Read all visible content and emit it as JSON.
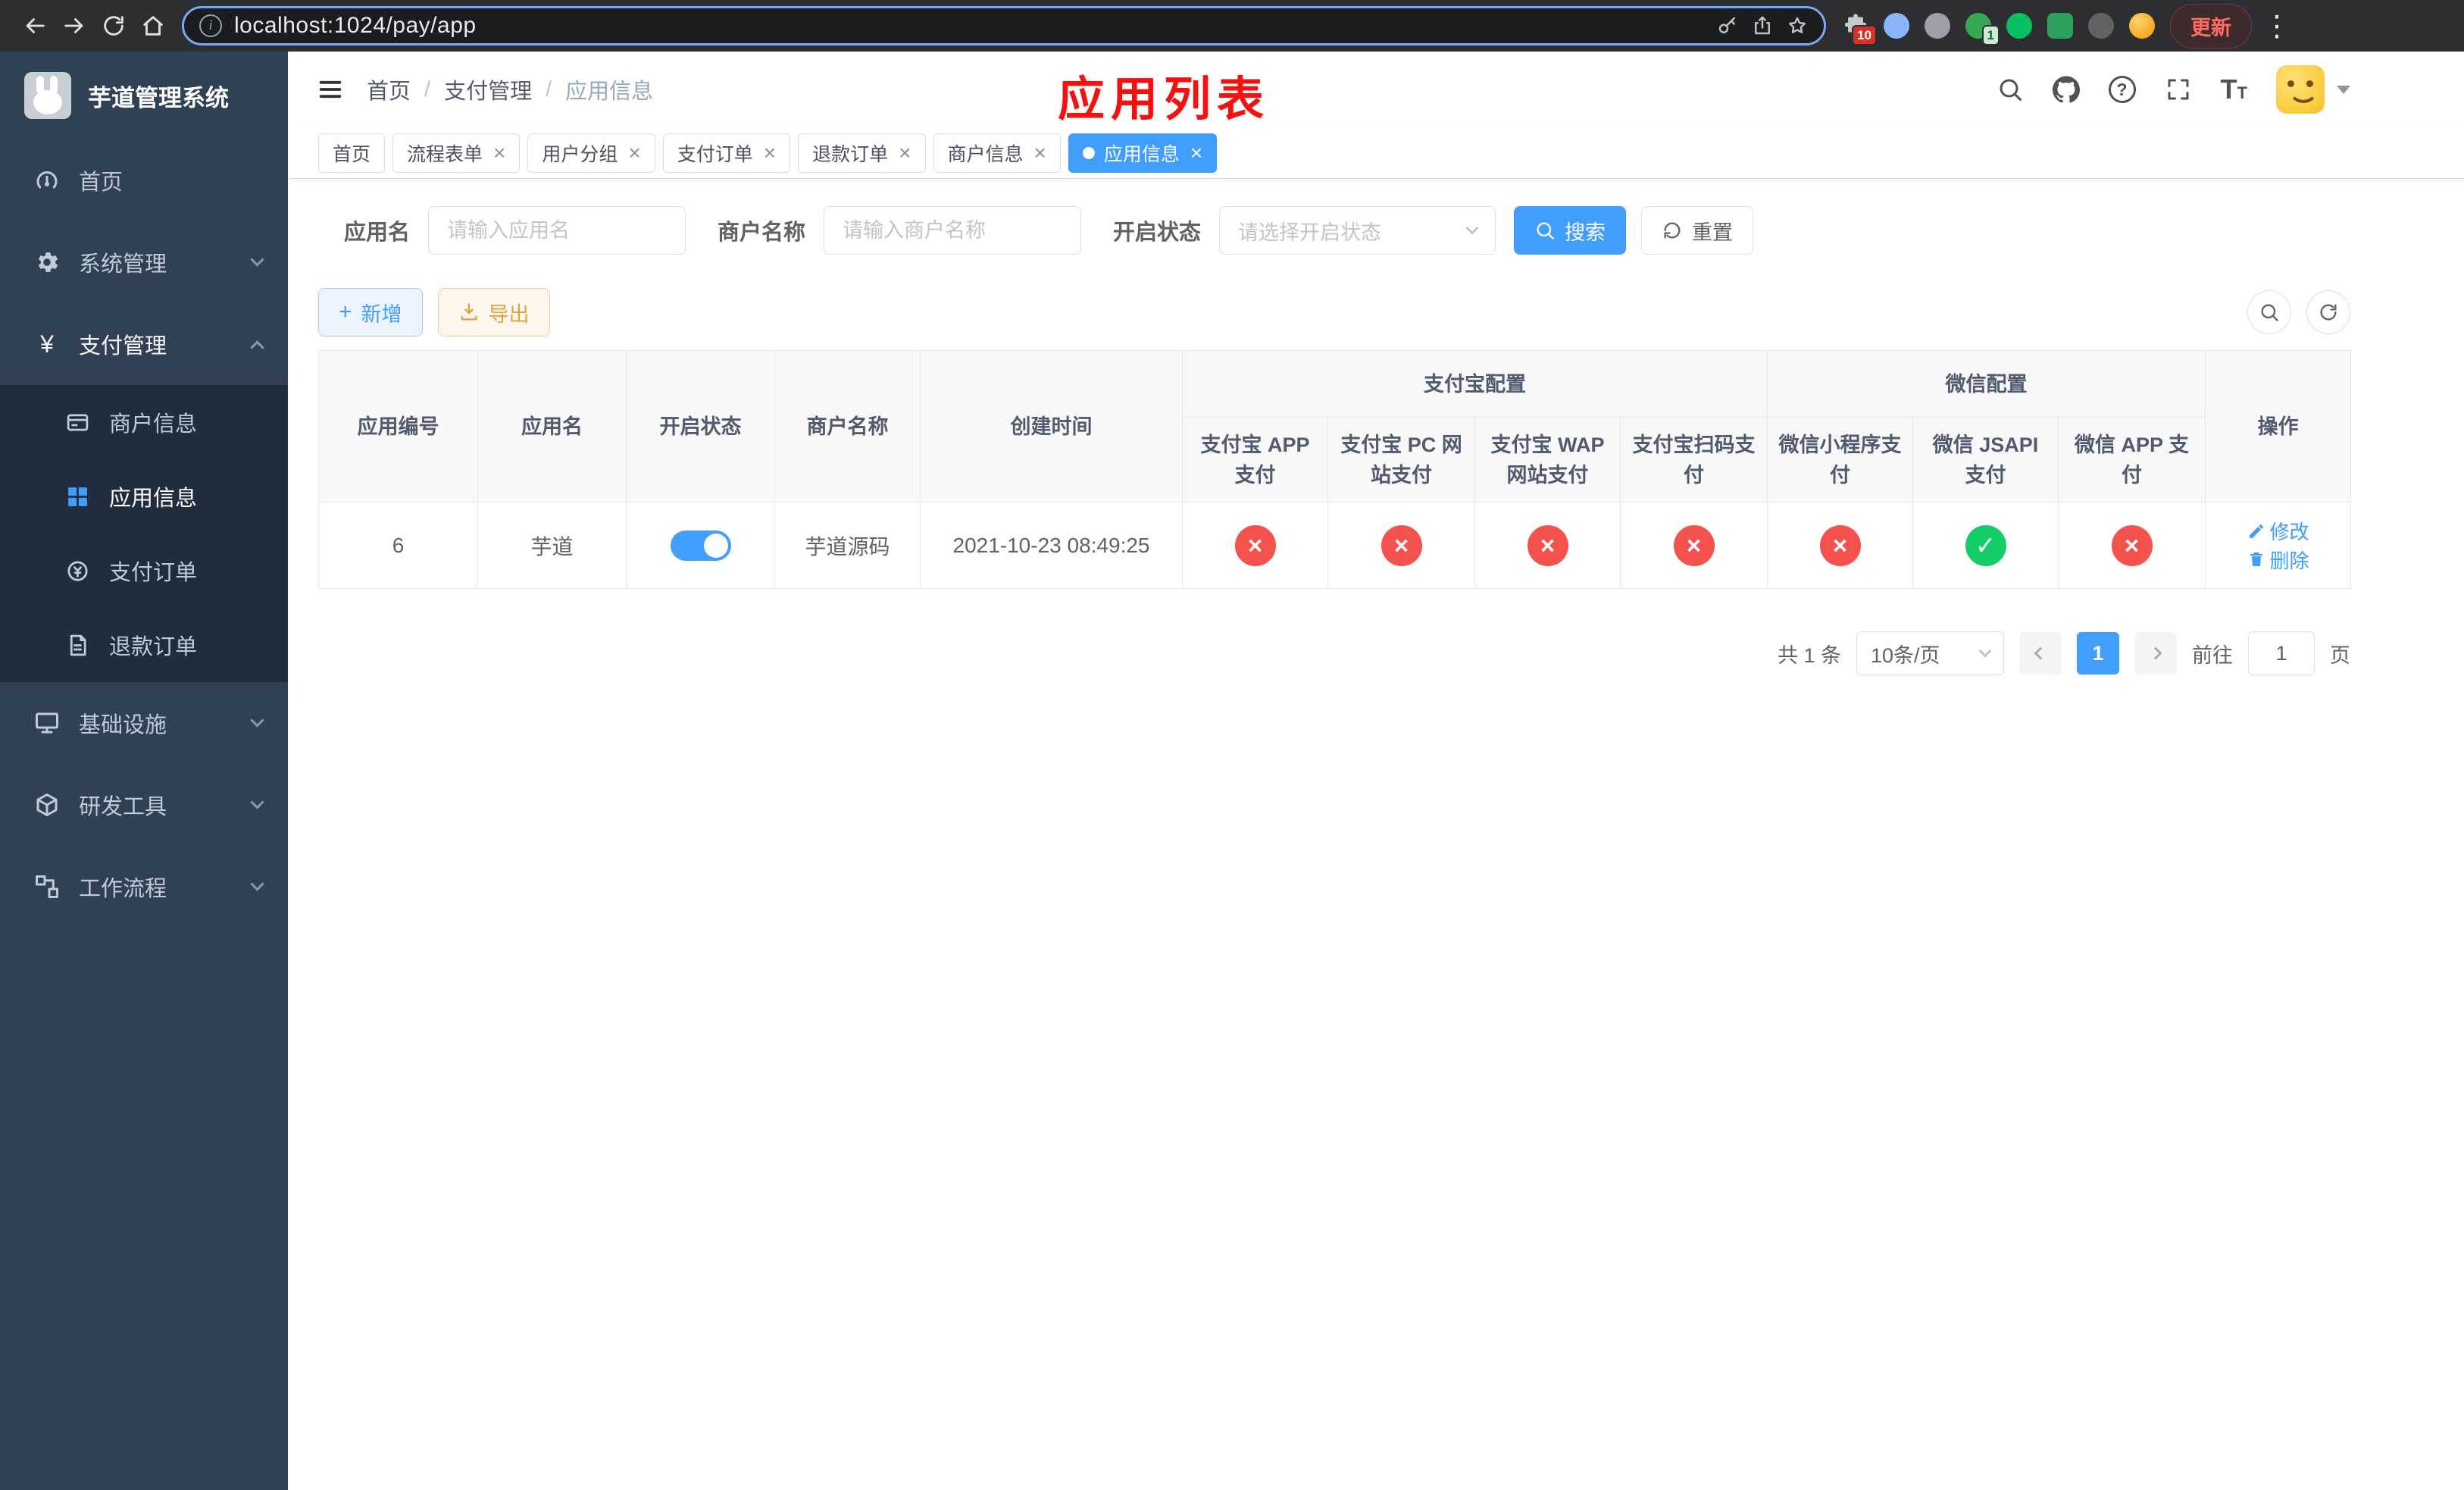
{
  "browser": {
    "url": "localhost:1024/pay/app",
    "update_label": "更新",
    "extensions_badge": "10",
    "extension_badge_green": "1"
  },
  "sidebar": {
    "title": "芋道管理系统",
    "items": {
      "home": "首页",
      "system": "系统管理",
      "payment": "支付管理",
      "infra": "基础设施",
      "devtools": "研发工具",
      "workflow": "工作流程"
    },
    "payment_children": {
      "merchant": "商户信息",
      "app": "应用信息",
      "pay_order": "支付订单",
      "refund_order": "退款订单"
    }
  },
  "header": {
    "breadcrumb": {
      "home": "首页",
      "section": "支付管理",
      "page": "应用信息"
    },
    "annotation": "应用列表"
  },
  "tabs": [
    {
      "label": "首页",
      "closable": false,
      "active": false
    },
    {
      "label": "流程表单",
      "closable": true,
      "active": false
    },
    {
      "label": "用户分组",
      "closable": true,
      "active": false
    },
    {
      "label": "支付订单",
      "closable": true,
      "active": false
    },
    {
      "label": "退款订单",
      "closable": true,
      "active": false
    },
    {
      "label": "商户信息",
      "closable": true,
      "active": false
    },
    {
      "label": "应用信息",
      "closable": true,
      "active": true
    }
  ],
  "filters": {
    "app_name": {
      "label": "应用名",
      "placeholder": "请输入应用名",
      "value": ""
    },
    "merchant_name": {
      "label": "商户名称",
      "placeholder": "请输入商户名称",
      "value": ""
    },
    "status": {
      "label": "开启状态",
      "placeholder": "请选择开启状态",
      "value": ""
    },
    "search_button": "搜索",
    "reset_button": "重置"
  },
  "toolbar": {
    "add_button": "新增",
    "export_button": "导出"
  },
  "table": {
    "simple_columns": [
      "应用编号",
      "应用名",
      "开启状态",
      "商户名称",
      "创建时间"
    ],
    "alipay_group": "支付宝配置",
    "alipay_columns": [
      "支付宝 APP 支付",
      "支付宝 PC 网站支付",
      "支付宝 WAP 网站支付",
      "支付宝扫码支付"
    ],
    "wechat_group": "微信配置",
    "wechat_columns": [
      "微信小程序支付",
      "微信 JSAPI 支付",
      "微信 APP 支付"
    ],
    "actions_column": "操作",
    "rows": [
      {
        "id": "6",
        "name": "芋道",
        "enabled": true,
        "merchant": "芋道源码",
        "created_at": "2021-10-23 08:49:25",
        "alipay_app": false,
        "alipay_pc": false,
        "alipay_wap": false,
        "alipay_qr": false,
        "wechat_mini": false,
        "wechat_jsapi": true,
        "wechat_app": false,
        "edit_label": "修改",
        "delete_label": "删除"
      }
    ]
  },
  "pagination": {
    "total": "共 1 条",
    "page_size": "10条/页",
    "current_page": "1",
    "goto_label": "前往",
    "goto_value": "1",
    "goto_unit": "页"
  },
  "colors": {
    "primary": "#409eff",
    "success": "#13ce66",
    "danger": "#f5524e",
    "warning": "#e6a23c",
    "sidebar_bg": "#304156",
    "submenu_bg": "#1f2d3d",
    "annotation": "#fa0f0f"
  }
}
